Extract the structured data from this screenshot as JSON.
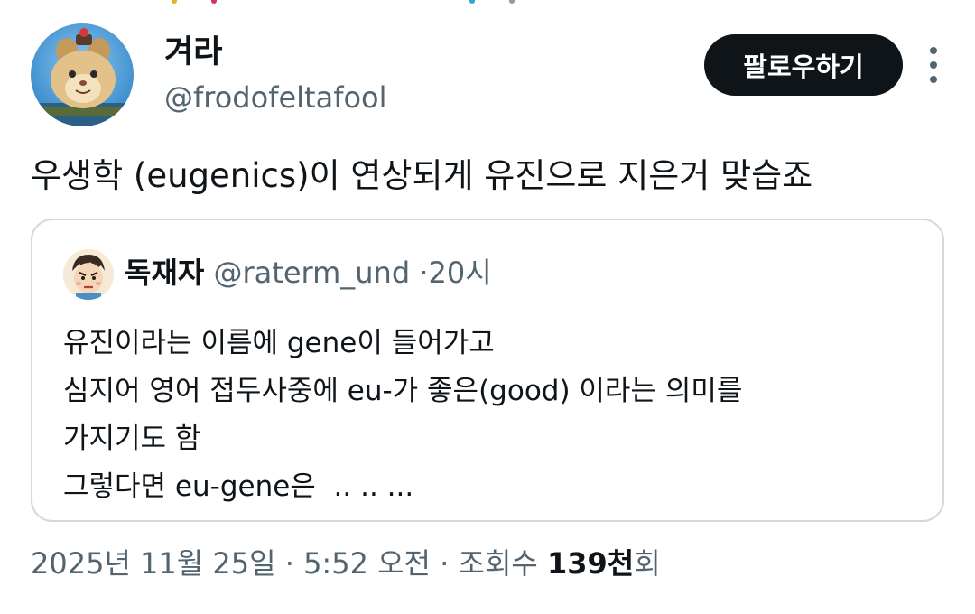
{
  "author": {
    "display_name": "겨라",
    "handle": "@frodofeltafool",
    "follow_label": "팔로우하기"
  },
  "tweet": {
    "text": "우생학 (eugenics)이 연상되게 유진으로 지은거 맞습죠"
  },
  "quoted_tweet": {
    "display_name": "독재자",
    "handle": "@raterm_und",
    "separator": "·",
    "time": "20시",
    "lines": [
      "유진이라는 이름에 gene이 들어가고",
      "심지어 영어 접두사중에 eu-가 좋은(good) 이라는 의미를",
      "가지기도 함",
      "그렇다면 eu-gene은  .. .. ..."
    ]
  },
  "meta": {
    "date": "2025년 11월 25일",
    "separator": "·",
    "time": "5:52 오전",
    "views_label": "조회수",
    "views_count": "139천",
    "views_suffix": "회"
  },
  "colors": {
    "text_primary": "#0f1419",
    "text_secondary": "#536471",
    "border": "#cfd9de",
    "button_bg": "#0f1419"
  },
  "icons": {
    "more": "more-dots-vertical-icon"
  }
}
